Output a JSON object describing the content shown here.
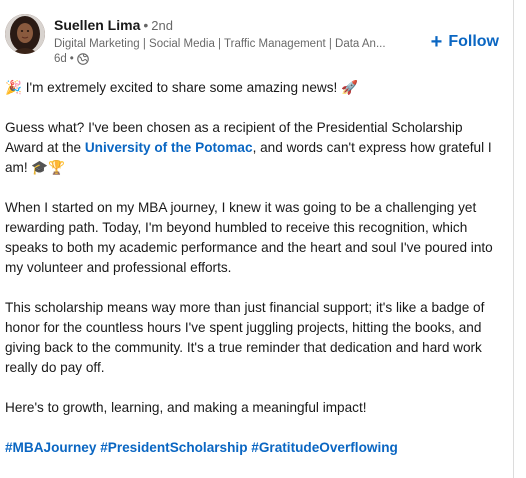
{
  "author": {
    "name": "Suellen Lima",
    "degree": "2nd",
    "degree_separator": "•",
    "headline": "Digital Marketing | Social Media | Traffic Management | Data An...",
    "posted": "6d",
    "meta_separator": "•",
    "visibility_icon": "globe-icon"
  },
  "follow": {
    "plus": "+",
    "label": "Follow"
  },
  "post": {
    "p1": "🎉 I'm extremely excited to share some amazing news! 🚀",
    "p2_before": "Guess what? I've been chosen as a recipient of the Presidential Scholarship Award at the ",
    "p2_link": "University of the Potomac",
    "p2_after": ", and words can't express how grateful I am! 🎓🏆",
    "p3": "When I started on my MBA journey, I knew it was going to be a challenging yet rewarding path. Today, I'm beyond humbled to receive this recognition, which speaks to both my academic performance and the heart and soul I've poured into my volunteer and professional efforts.",
    "p4": "This scholarship means way more than just financial support; it's like a badge of honor for the countless hours I've spent juggling projects, hitting the books, and giving back to the community. It's a true reminder that dedication and hard work really do pay off.",
    "p5": "Here's to growth, learning, and making a meaningful impact!",
    "hashtags": [
      "#MBAJourney",
      "#PresidentScholarship",
      "#GratitudeOverflowing"
    ]
  },
  "colors": {
    "link": "#0a66c2",
    "text": "#1f1f1f",
    "secondary": "#666666"
  }
}
